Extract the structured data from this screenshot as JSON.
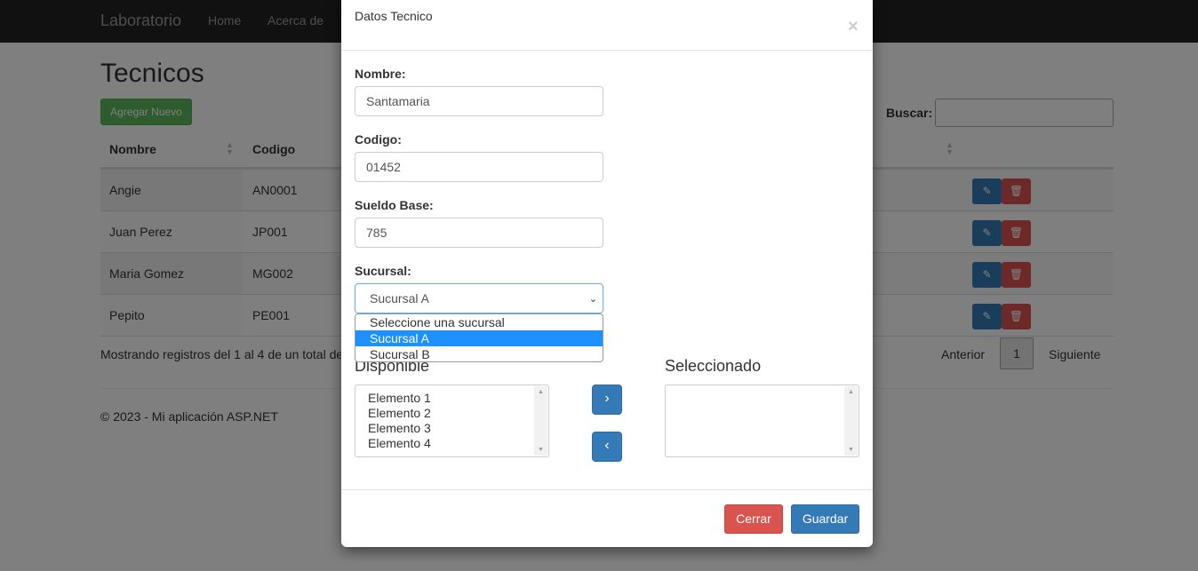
{
  "navbar": {
    "brand": "Laboratorio",
    "links": [
      "Home",
      "Acerca de"
    ]
  },
  "page": {
    "title": "Tecnicos",
    "add_button": "Agregar Nuevo",
    "search_label": "Buscar:",
    "columns": [
      "Nombre",
      "Codigo"
    ],
    "rows": [
      {
        "nombre": "Angie",
        "codigo": "AN0001"
      },
      {
        "nombre": "Juan Perez",
        "codigo": "JP001"
      },
      {
        "nombre": "Maria Gomez",
        "codigo": "MG002"
      },
      {
        "nombre": "Pepito",
        "codigo": "PE001"
      }
    ],
    "info": "Mostrando registros del 1 al 4 de un total de",
    "pager": {
      "prev": "Anterior",
      "current": "1",
      "next": "Siguiente"
    },
    "footer": "© 2023 - Mi aplicación ASP.NET"
  },
  "modal": {
    "title": "Datos Tecnico",
    "close": "×",
    "fields": {
      "nombre_label": "Nombre:",
      "nombre_value": "Santamaria",
      "codigo_label": "Codigo:",
      "codigo_value": "01452",
      "sueldo_label": "Sueldo Base:",
      "sueldo_value": "785",
      "sucursal_label": "Sucursal:",
      "sucursal_value": "Sucursal A"
    },
    "sucursal_options": [
      "Seleccione una sucursal",
      "Sucursal A",
      "Sucursal B"
    ],
    "disponible_title": "Disponible",
    "seleccionado_title": "Seleccionado",
    "disponible_items": [
      "Elemento 1",
      "Elemento 2",
      "Elemento 3",
      "Elemento 4"
    ],
    "move_right": "›",
    "move_left": "‹",
    "cerrar": "Cerrar",
    "guardar": "Guardar"
  },
  "colors": {
    "primary": "#337ab7",
    "danger": "#d9534f",
    "success": "#5cb85c",
    "navbar": "#222222"
  }
}
